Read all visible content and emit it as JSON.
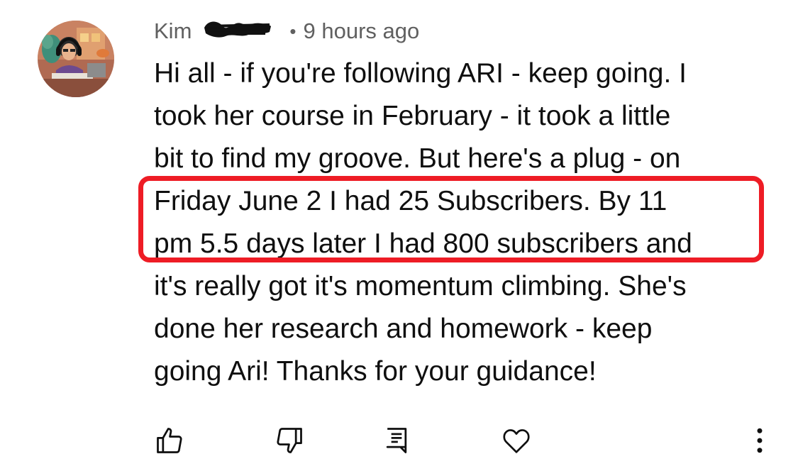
{
  "comment": {
    "author": "Kim",
    "separator": "•",
    "timestamp": "9 hours ago",
    "lines": [
      "Hi all - if you're following ARI - keep going. I",
      "took her course in February - it took a little",
      "bit to find my groove. But here's a plug - on",
      "Friday June 2 I had 25 Subscribers. By 11",
      "pm 5.5 days later I had 800 subscribers and",
      "it's really got it's momentum climbing. She's",
      "done her research and homework - keep",
      "going Ari! Thanks for your guidance!"
    ]
  },
  "highlight": {
    "color": "#ee1c25"
  },
  "actions": [
    {
      "icon": "thumbs-up-icon"
    },
    {
      "icon": "thumbs-down-icon"
    },
    {
      "icon": "reply-icon"
    },
    {
      "icon": "heart-icon"
    },
    {
      "icon": "more-vertical-icon"
    }
  ],
  "colors": {
    "text": "#0f0f0f",
    "meta": "#606060",
    "highlight": "#ee1c25"
  }
}
